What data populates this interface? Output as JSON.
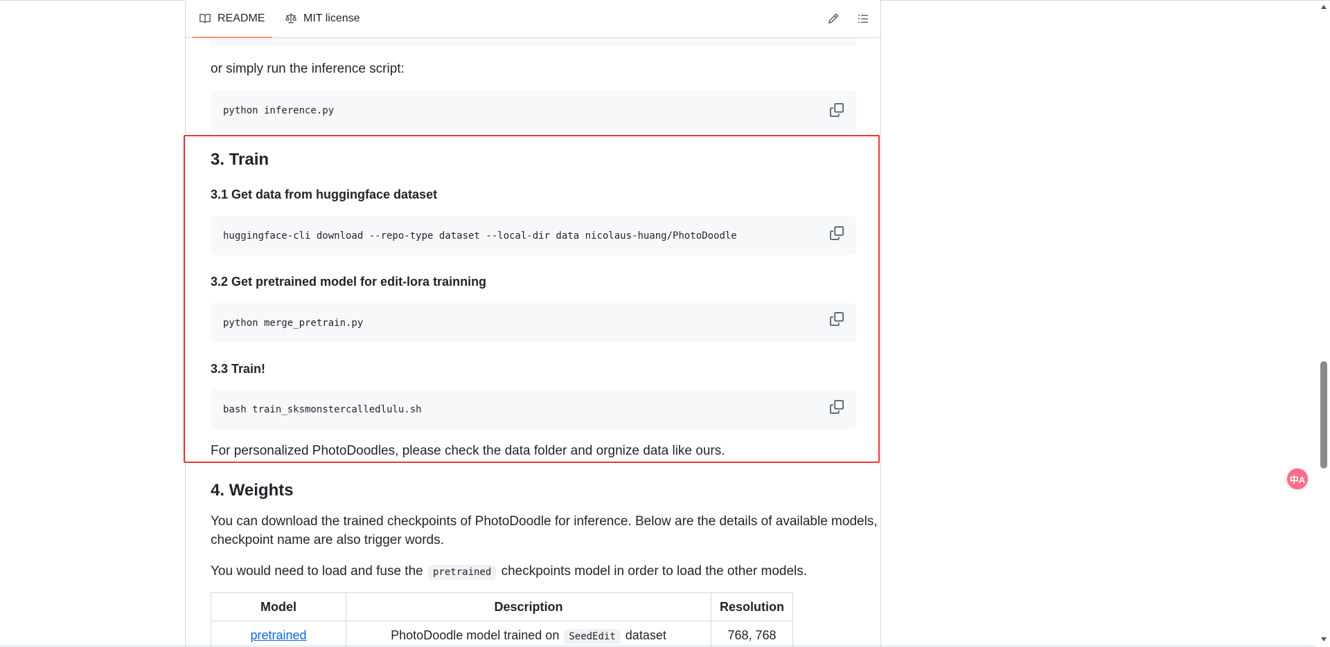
{
  "tabs": [
    {
      "label": "README",
      "icon": "book-icon"
    },
    {
      "label": "MIT license",
      "icon": "law-icon"
    }
  ],
  "text": {
    "run_inference": "or simply run the inference script:",
    "train_heading": "3. Train",
    "sub1": "3.1 Get data from huggingface dataset",
    "sub2": "3.2 Get pretrained model for edit-lora trainning",
    "sub3": "3.3 Train!",
    "personalized": "For personalized PhotoDoodles, please check the data folder and orgnize data like ours.",
    "weights_heading": "4. Weights",
    "weights_p1_line1": "You can download the trained checkpoints of PhotoDoodle for inference. Below are the details of available models,",
    "weights_p1_line2": "checkpoint name are also trigger words.",
    "weights_p2_before": "You would need to load and fuse the",
    "weights_p2_code": "pretrained",
    "weights_p2_after": "checkpoints model in order to load the other models."
  },
  "code_blocks": [
    "python inference.py",
    "huggingface-cli download --repo-type dataset --local-dir data nicolaus-huang/PhotoDoodle",
    "python merge_pretrain.py",
    "bash train_sksmonstercalledlulu.sh"
  ],
  "table": {
    "headers": [
      "Model",
      "Description",
      "Resolution"
    ],
    "row1": {
      "model": "pretrained",
      "desc_before": "PhotoDoodle model trained on",
      "desc_code": "SeedEdit",
      "desc_after": "dataset",
      "resolution": "768, 768"
    }
  },
  "translate_label": "中A",
  "colors": {
    "highlight": "#e53935",
    "link": "#0969da",
    "tab_underline": "#fd8c73",
    "code_bg": "#f6f8fa"
  }
}
